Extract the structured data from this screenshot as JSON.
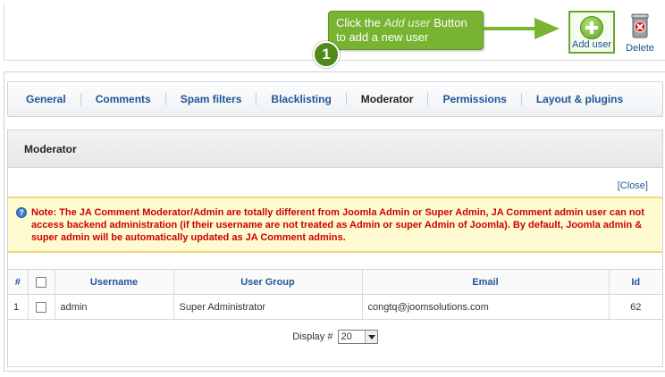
{
  "callout": {
    "line1_prefix": "Click the ",
    "line1_em": "Add user",
    "line1_suffix": " Button",
    "line2": "to add a new user",
    "step": "1"
  },
  "toolbar": {
    "add_label": "Add user",
    "delete_label": "Delete"
  },
  "tabs": [
    {
      "label": "General"
    },
    {
      "label": "Comments"
    },
    {
      "label": "Spam filters"
    },
    {
      "label": "Blacklisting"
    },
    {
      "label": "Moderator"
    },
    {
      "label": "Permissions"
    },
    {
      "label": "Layout & plugins"
    }
  ],
  "panel": {
    "title": "Moderator",
    "close_label": "[Close]",
    "notice": "Note: The JA Comment Moderator/Admin are totally different from Joomla Admin or Super Admin, JA Comment admin user can not access backend administration (if their username are not treated as Admin or super Admin of Joomla). By default, Joomla admin & super admin will be automatically updated as JA Comment admins."
  },
  "table": {
    "headers": {
      "num": "#",
      "username": "Username",
      "group": "User Group",
      "email": "Email",
      "id": "Id"
    },
    "rows": [
      {
        "num": "1",
        "username": "admin",
        "group": "Super Administrator",
        "email": "congtq@joomsolutions.com",
        "id": "62"
      }
    ]
  },
  "pager": {
    "label": "Display #",
    "value": "20"
  },
  "colors": {
    "accent": "#78b432",
    "link": "#1f5599",
    "notice_text": "#cc0000",
    "notice_bg": "#fffbd0"
  }
}
